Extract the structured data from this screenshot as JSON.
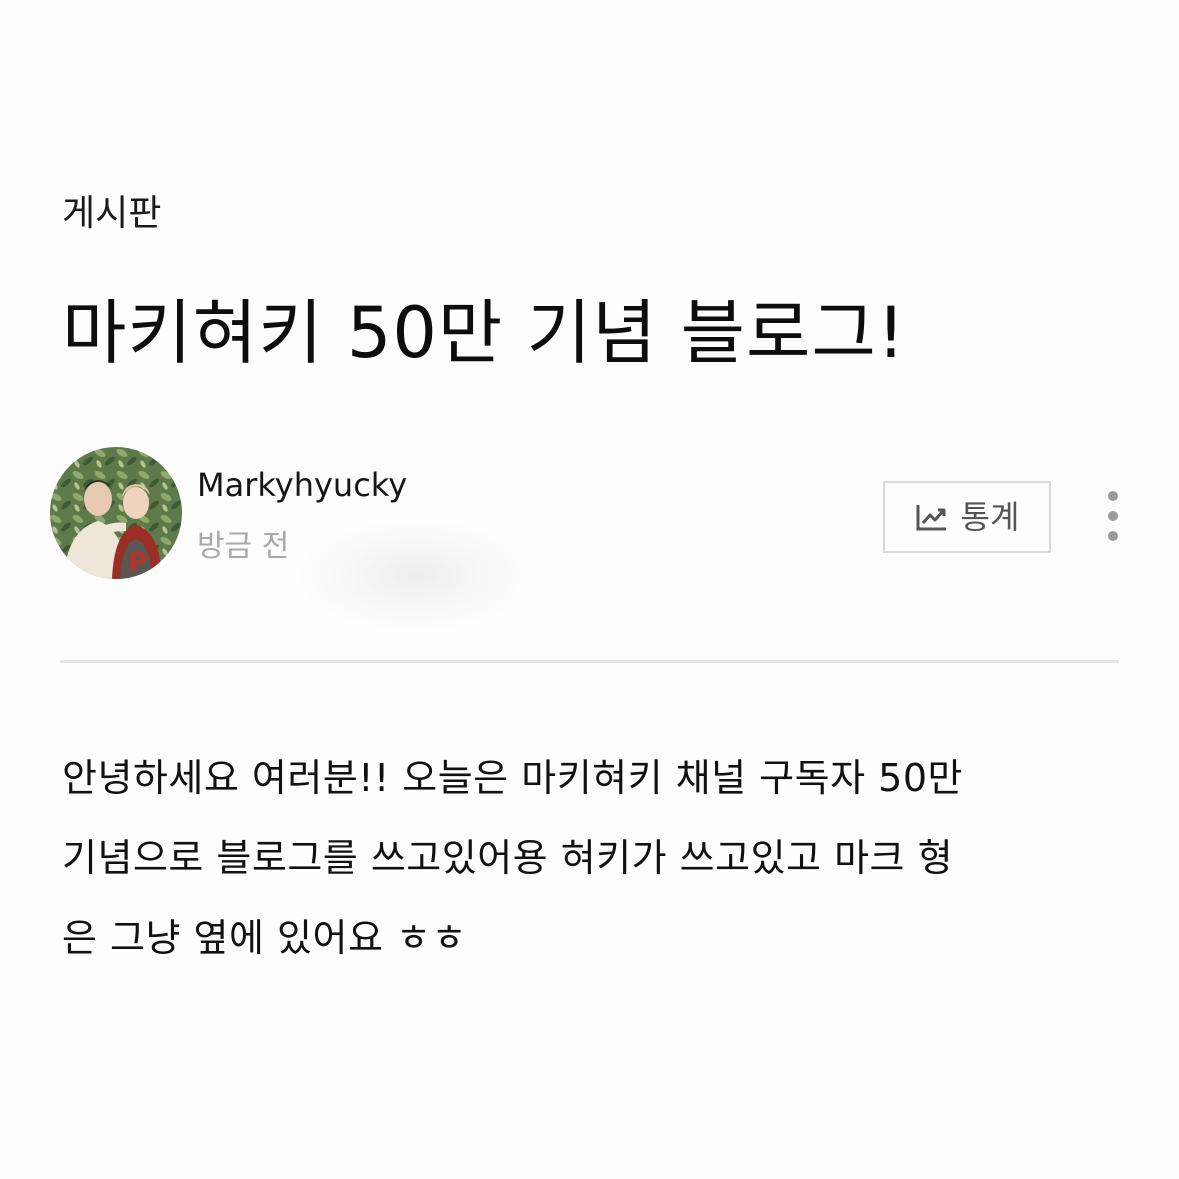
{
  "board": {
    "label": "게시판"
  },
  "post": {
    "title": "마키혀키 50만 기념 블로그!",
    "author": {
      "name": "Markyhyucky",
      "time": "방금 전"
    },
    "actions": {
      "stats_label": "통계",
      "stats_icon": "trend-chart-icon",
      "more_icon": "vertical-ellipsis-icon"
    },
    "body": {
      "lines": [
        "안녕하세요 여러분!! 오늘은 마키혀키 채널 구독자 50만",
        "기념으로 블로그를 쓰고있어용 혀키가 쓰고있고 마크 형",
        "은 그냥 옆에 있어요 ㅎㅎ"
      ]
    }
  },
  "colors": {
    "background": "#fdfdfd",
    "text": "#111111",
    "muted": "#a9a9a9",
    "divider": "#e6e6e6",
    "button_border": "#d9d9d9"
  }
}
